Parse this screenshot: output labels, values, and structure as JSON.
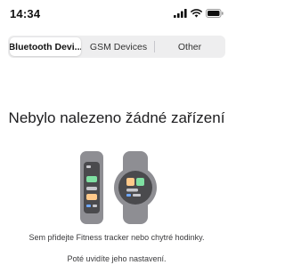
{
  "status_bar": {
    "time": "14:34",
    "icons": [
      "signal-icon",
      "wifi-icon",
      "battery-icon"
    ]
  },
  "segmented_control": {
    "tabs": [
      {
        "label": "Bluetooth Devi...",
        "selected": true
      },
      {
        "label": "GSM Devices",
        "selected": false
      },
      {
        "label": "Other",
        "selected": false
      }
    ]
  },
  "empty_state": {
    "title": "Nebylo nalezeno žádné zařízení",
    "illustration": "fitness-tracker-and-smartwatch-icon",
    "line1": "Sem přidejte Fitness tracker nebo chytré hodinky.",
    "line2": "Poté uvidíte jeho nastavení."
  },
  "colors": {
    "device_body": "#8e8e93",
    "device_screen": "#4a4a4d",
    "tile_green": "#7fe0a2",
    "tile_orange": "#ffc98a",
    "tile_blue": "#6fa8ff",
    "segment_background": "#eeeeef"
  }
}
